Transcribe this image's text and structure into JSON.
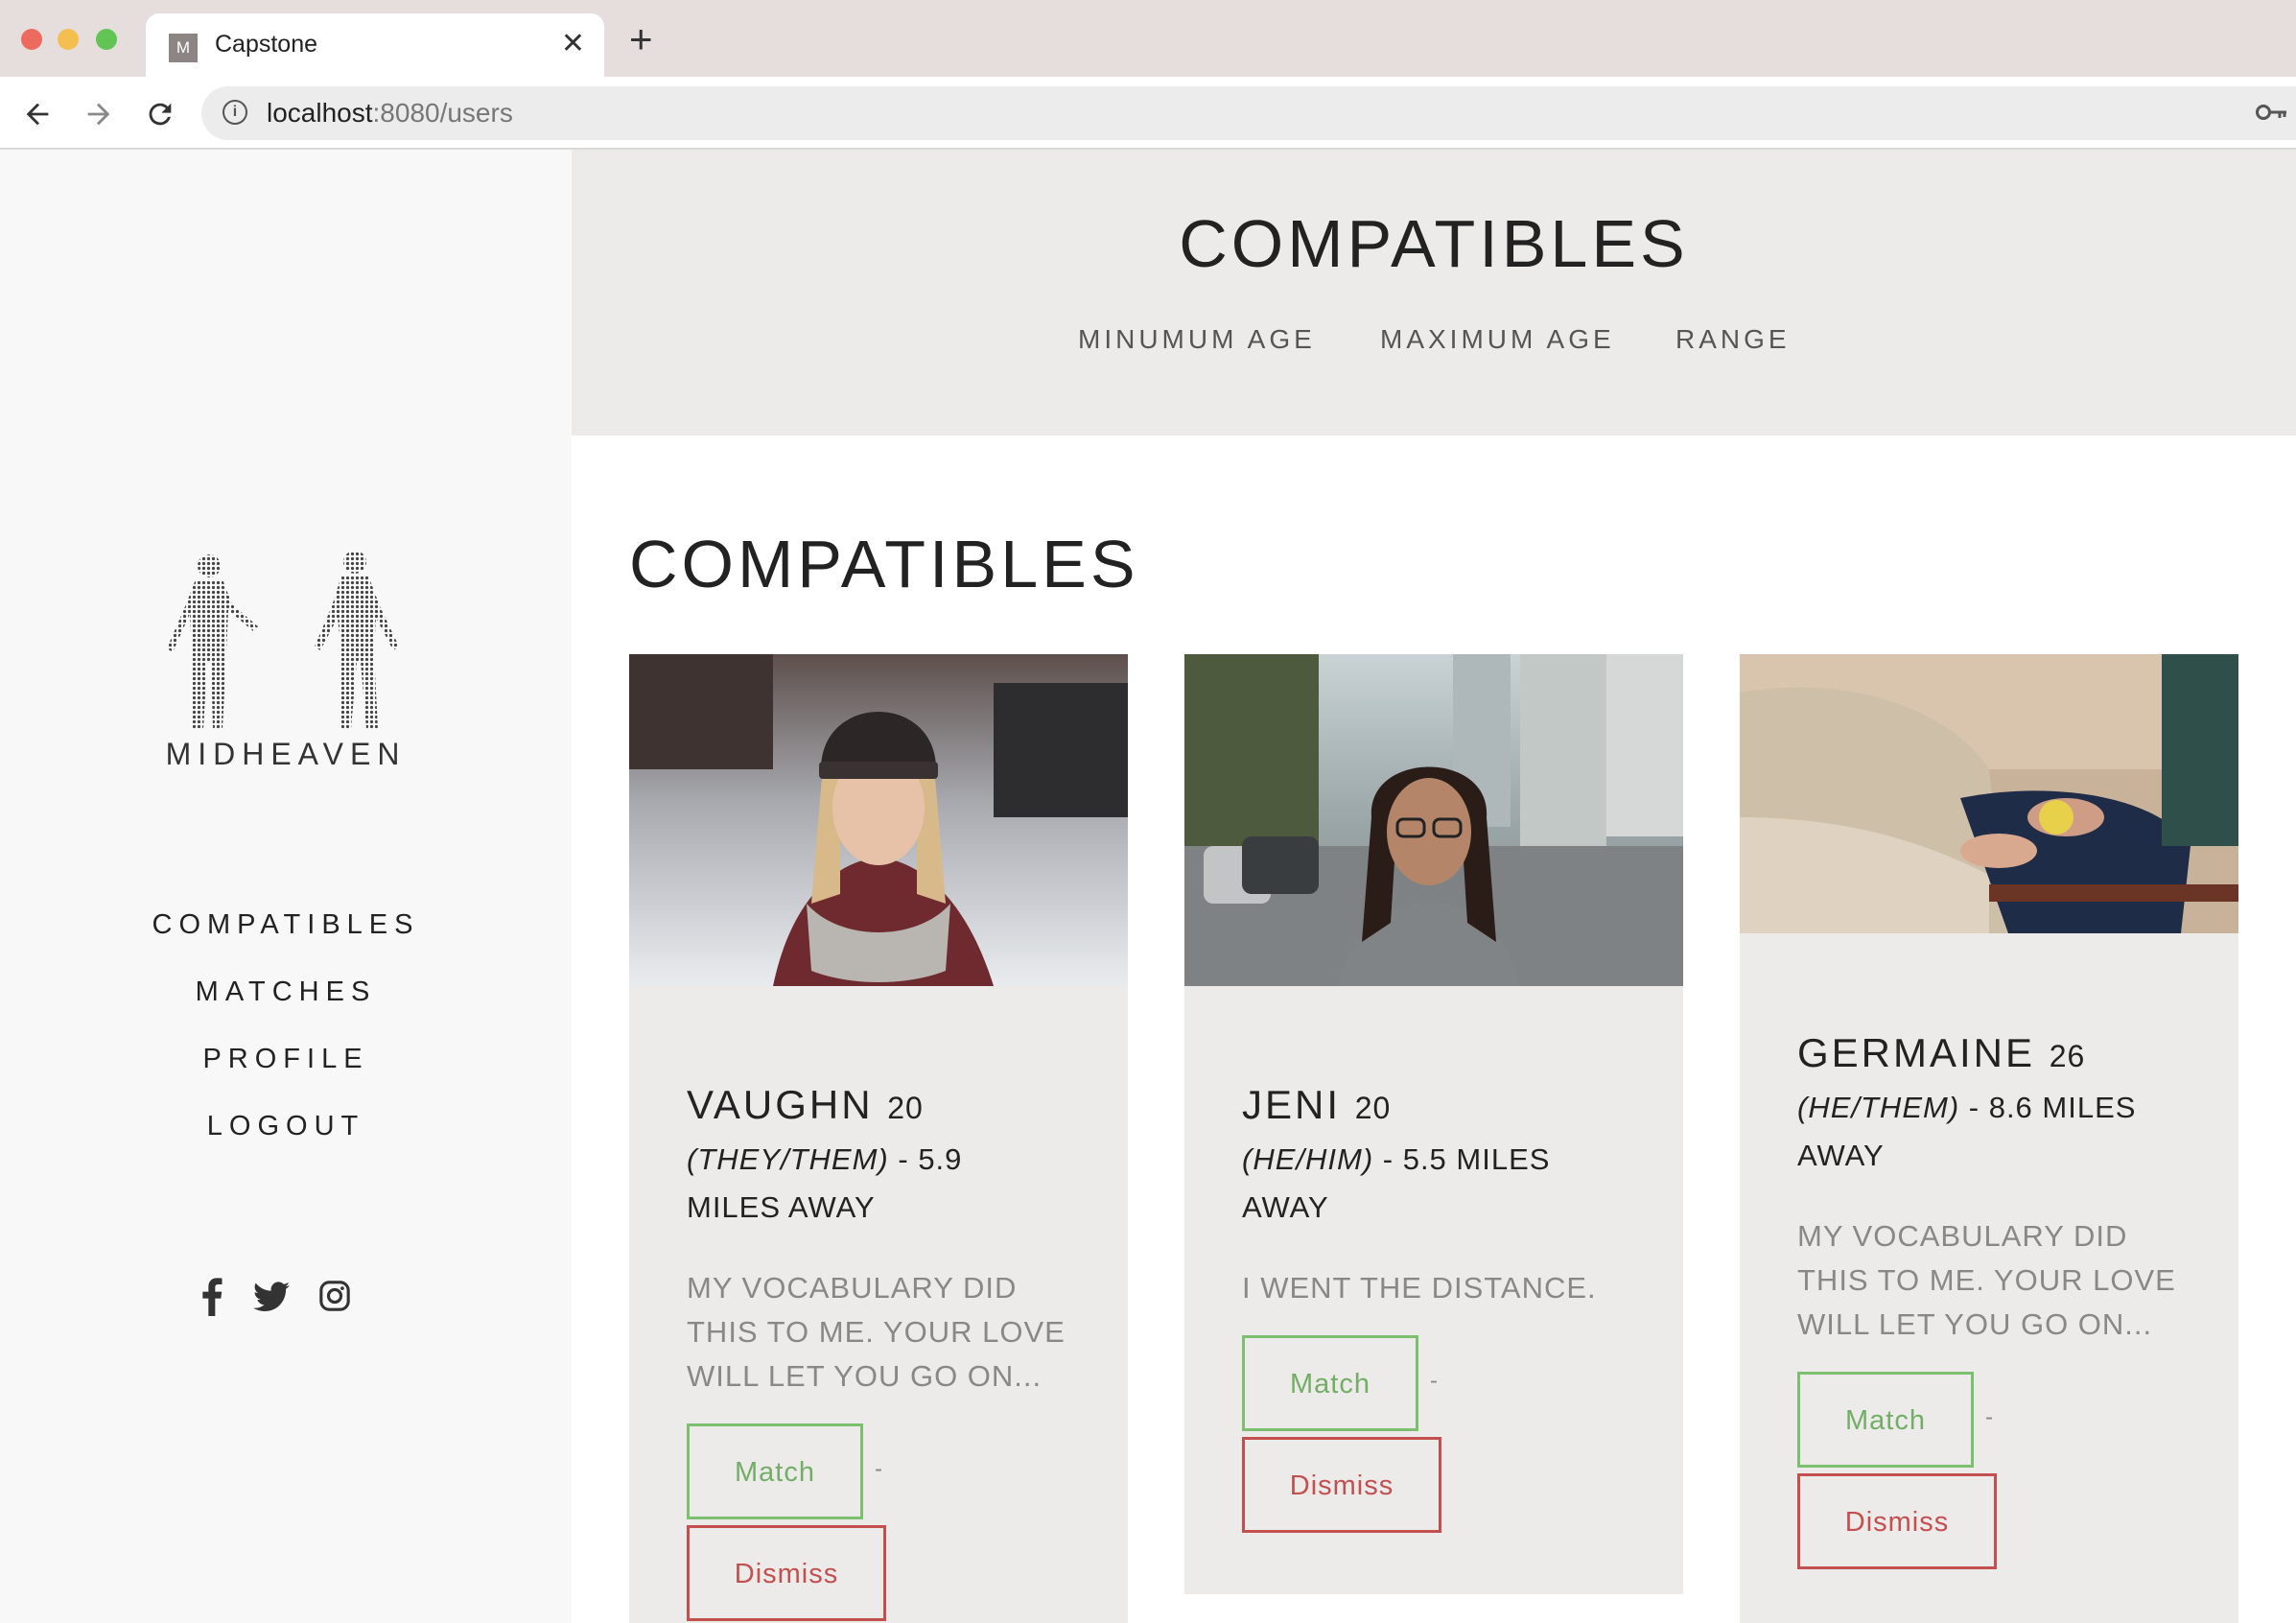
{
  "browser": {
    "tab_title": "Capstone",
    "tab_favicon_letter": "M",
    "new_tab_symbol": "+",
    "close_symbol": "✕",
    "url_host": "localhost",
    "url_rest": ":8080/users",
    "traffic_colors": [
      "#ed6a5e",
      "#f5bf4f",
      "#61c454"
    ]
  },
  "sidebar": {
    "brand": "MIDHEAVEN",
    "menu": [
      "COMPATIBLES",
      "MATCHES",
      "PROFILE",
      "LOGOUT"
    ],
    "social_icons": [
      "facebook-icon",
      "twitter-icon",
      "instagram-icon"
    ]
  },
  "header": {
    "title": "COMPATIBLES",
    "filters": [
      "MINUMUM AGE",
      "MAXIMUM AGE",
      "RANGE"
    ]
  },
  "main": {
    "title": "COMPATIBLES",
    "cards": [
      {
        "name": "VAUGHN",
        "age": "20",
        "pronouns": "(THEY/THEM)",
        "distance_line1": " - 5.9",
        "distance_line2": "MILES AWAY",
        "bio_lines": [
          "MY VOCABULARY DID",
          "THIS TO ME. YOUR LOVE",
          "WILL LET YOU GO ON..."
        ],
        "match_label": "Match",
        "dismiss_label": "Dismiss",
        "separator": "-"
      },
      {
        "name": "JENI",
        "age": "20",
        "pronouns": "(HE/HIM)",
        "distance_line1": " - 5.5 MILES",
        "distance_line2": "AWAY",
        "bio_lines": [
          "I WENT THE DISTANCE."
        ],
        "match_label": "Match",
        "dismiss_label": "Dismiss",
        "separator": "-"
      },
      {
        "name": "GERMAINE",
        "age": "26",
        "pronouns": "(HE/THEM)",
        "distance_line1": " - 8.6 MILES",
        "distance_line2": "AWAY",
        "bio_lines": [
          "MY VOCABULARY DID",
          "THIS TO ME. YOUR LOVE",
          "WILL LET YOU GO ON..."
        ],
        "match_label": "Match",
        "dismiss_label": "Dismiss",
        "separator": "-"
      }
    ]
  },
  "colors": {
    "match": "#73ae66",
    "dismiss": "#c44f4f",
    "card_bg": "#edebea"
  }
}
